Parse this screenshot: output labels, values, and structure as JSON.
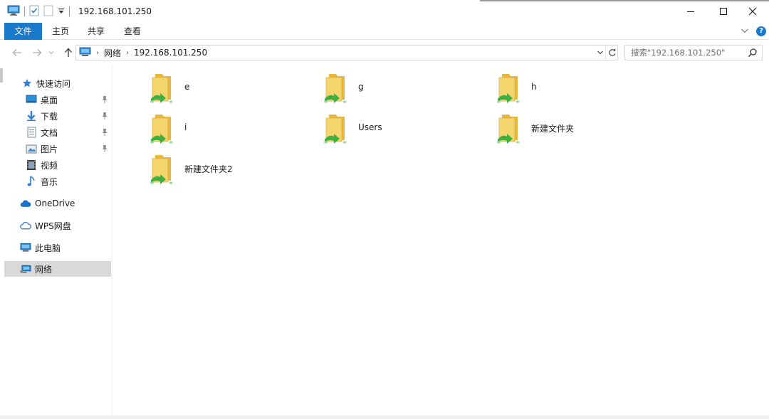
{
  "window": {
    "title": "192.168.101.250",
    "controls": {
      "minimize": "minimize",
      "maximize": "maximize",
      "close": "close"
    }
  },
  "ribbon": {
    "tabs": [
      {
        "label": "文件",
        "active": true
      },
      {
        "label": "主页"
      },
      {
        "label": "共享"
      },
      {
        "label": "查看"
      }
    ]
  },
  "address": {
    "breadcrumb": [
      "网络",
      "192.168.101.250"
    ],
    "search_placeholder": "搜索\"192.168.101.250\""
  },
  "sidebar": {
    "quick_access": "快速访问",
    "pinned": [
      {
        "label": "桌面",
        "icon": "desktop-icon",
        "pinned": true
      },
      {
        "label": "下载",
        "icon": "download-icon",
        "pinned": true
      },
      {
        "label": "文档",
        "icon": "document-icon",
        "pinned": true
      },
      {
        "label": "图片",
        "icon": "picture-icon",
        "pinned": true
      },
      {
        "label": "视频",
        "icon": "video-icon",
        "pinned": false
      },
      {
        "label": "音乐",
        "icon": "music-icon",
        "pinned": false
      }
    ],
    "onedrive": "OneDrive",
    "wps": "WPS网盘",
    "this_pc": "此电脑",
    "network": "网络"
  },
  "content": {
    "items": [
      {
        "name": "e"
      },
      {
        "name": "g"
      },
      {
        "name": "h"
      },
      {
        "name": "i"
      },
      {
        "name": "Users"
      },
      {
        "name": "新建文件夹"
      },
      {
        "name": "新建文件夹2"
      }
    ]
  },
  "colors": {
    "accent": "#1979ca",
    "folder": "#f5d56e",
    "share": "#3cb043",
    "selected": "#d9d9d9"
  }
}
